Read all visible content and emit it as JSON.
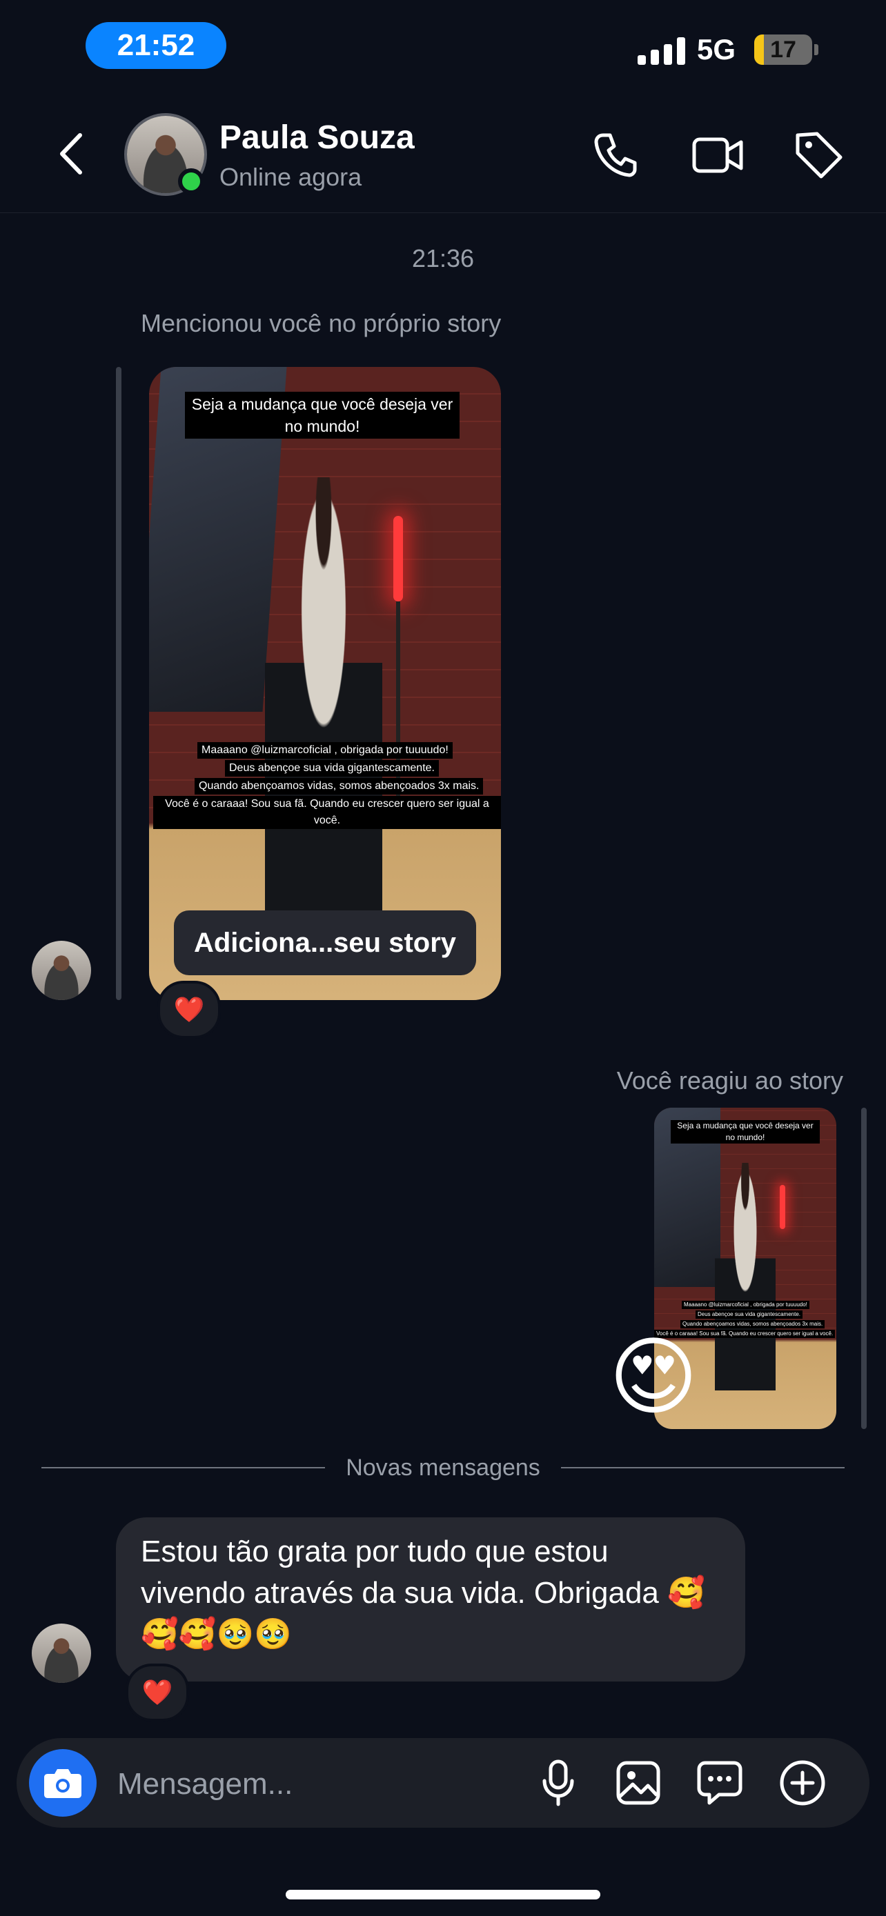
{
  "status_bar": {
    "time": "21:52",
    "network": "5G",
    "battery_level": "17",
    "battery_fraction": 0.17
  },
  "header": {
    "name": "Paula Souza",
    "status": "Online agora"
  },
  "thread": {
    "timestamp": "21:36",
    "mention_note": "Mencionou você no próprio story",
    "story": {
      "caption_top": "Seja a mudança que você deseja ver no mundo!",
      "caption_lines": [
        "Maaaano @luizmarcoficial , obrigada por tuuuudo!",
        "Deus abençoe sua vida gigantescamente.",
        "Quando abençoamos vidas, somos abençoados 3x mais.",
        "Você é o caraaa! Sou sua fã.  Quando eu crescer quero ser igual a você."
      ],
      "add_button": "Adiciona...seu story",
      "reaction": "❤️"
    },
    "reacted_note": "Você reagiu ao story",
    "my_reaction": "😍",
    "new_messages_label": "Novas mensagens",
    "message": {
      "text": "Estou tão grata por tudo que estou vivendo através da sua vida. Obrigada 🥰🥰🥰🥹🥹",
      "reaction": "❤️"
    }
  },
  "composer": {
    "placeholder": "Mensagem..."
  },
  "icons": [
    "back-icon",
    "phone-icon",
    "video-icon",
    "tag-icon",
    "camera-icon",
    "mic-icon",
    "gallery-icon",
    "sticker-icon",
    "plus-icon"
  ]
}
